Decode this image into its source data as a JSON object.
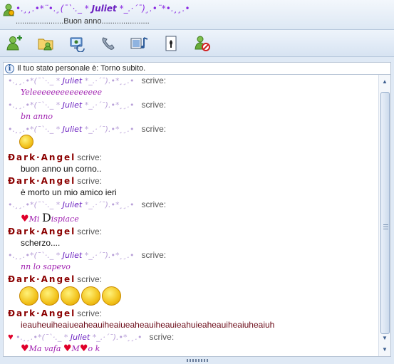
{
  "header": {
    "contact_deco_left": "•.¸¸.•*¨•.¸(¯`·._ *",
    "contact_name": "Juliet",
    "contact_deco_right": "*_.·´¯)¸.•¨*•.¸¸.•",
    "personal_message": "......................Buon anno......................"
  },
  "toolbar": {
    "icons": [
      "invite-contact-icon",
      "send-files-icon",
      "webcam-icon",
      "call-icon",
      "video-call-icon",
      "games-icon",
      "block-contact-icon"
    ]
  },
  "infobar": {
    "text": "Il tuo stato personale è: Torno subito."
  },
  "juliet": {
    "deco_left": "•.¸¸.•*(¯`·._ *",
    "name": "Juliet",
    "deco_right": "*_.·´¯).•*¸¸.•"
  },
  "dark": {
    "name": "Đark·Angel"
  },
  "writes_label": "scrive:",
  "messages": {
    "m1": "Yeleeeeeeeeeeeeeee",
    "m2": "bn anno",
    "m4": "buon anno un corno..",
    "m5": "è morto un mio amico ieri",
    "m6_prefix": "Mi",
    "m6_suffix": "ispiace",
    "m6_d": "D",
    "m7": "scherzo....",
    "m8": "nn lo sapevo",
    "m10": "ieauheuiheaiueaheauiheaiueaheauiheauieahuieaheauiheaiuheaiuh",
    "m11_a": "Ma vafa",
    "m11_m": "M",
    "m11_o": "o k"
  },
  "colors": {
    "juliet": "#8a2be2",
    "dark_angel": "#8b0000",
    "heart": "#e0002a"
  }
}
